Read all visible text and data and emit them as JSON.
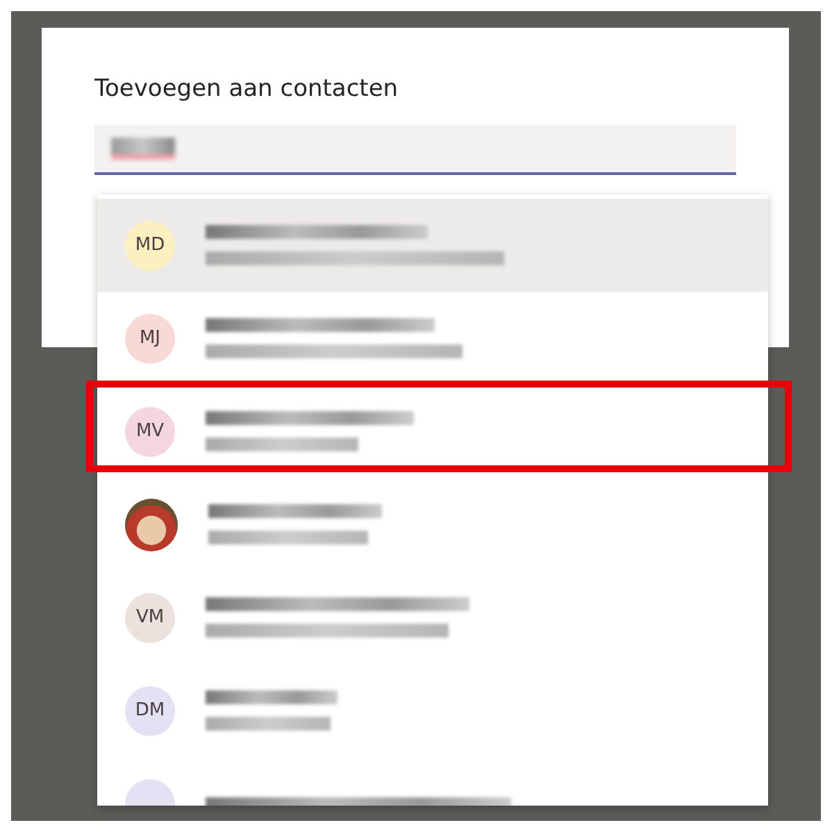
{
  "dialog": {
    "title": "Toevoegen aan contacten"
  },
  "search": {
    "value_blurred": true,
    "spellcheck_error": true
  },
  "contacts": [
    {
      "kind": "initials",
      "initials": "MD",
      "color": "#fcefc0",
      "hovered": true,
      "marked": false
    },
    {
      "kind": "initials",
      "initials": "MJ",
      "color": "#f9d9d6",
      "hovered": false,
      "marked": false
    },
    {
      "kind": "initials",
      "initials": "MV",
      "color": "#f6d5e2",
      "hovered": false,
      "marked": true
    },
    {
      "kind": "photo",
      "hovered": false,
      "marked": false
    },
    {
      "kind": "initials",
      "initials": "VM",
      "color": "#ebe1dd",
      "hovered": false,
      "marked": false
    },
    {
      "kind": "initials",
      "initials": "DM",
      "color": "#e3e1f4",
      "hovered": false,
      "marked": false
    },
    {
      "kind": "initials",
      "color": "#e3e1f4",
      "hovered": false,
      "marked": false
    }
  ]
}
